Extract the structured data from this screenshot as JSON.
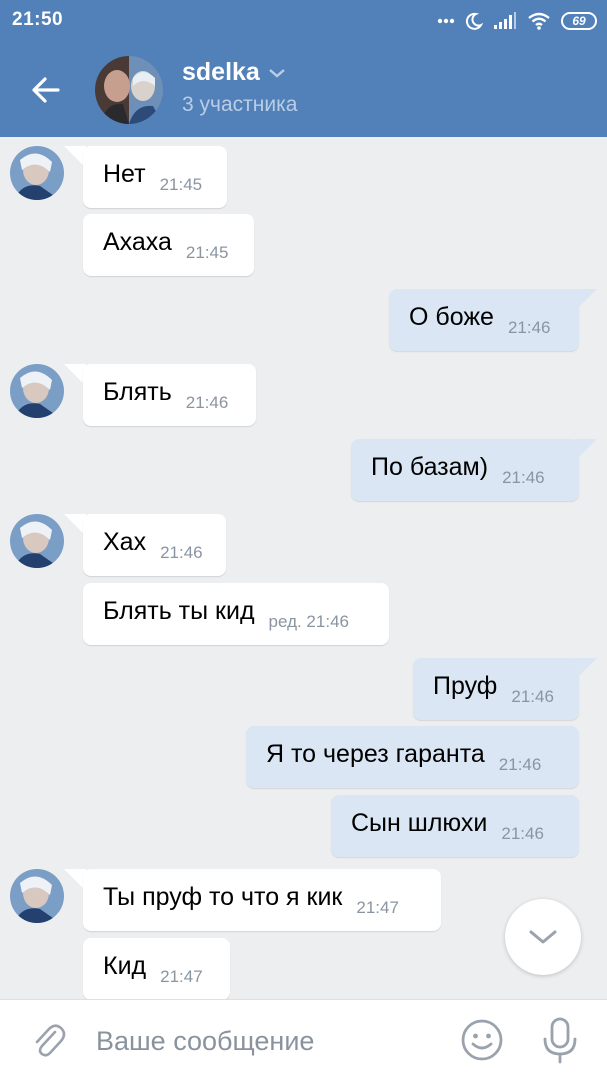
{
  "status_bar": {
    "time": "21:50",
    "battery": "69"
  },
  "header": {
    "title": "sdelka",
    "subtitle": "3 участника"
  },
  "messages": [
    {
      "dir": "in",
      "text": "Нет",
      "time": "21:45"
    },
    {
      "dir": "in",
      "text": "Ахаха",
      "time": "21:45"
    },
    {
      "dir": "out",
      "text": "О боже",
      "time": "21:46"
    },
    {
      "dir": "in",
      "text": "Блять",
      "time": "21:46"
    },
    {
      "dir": "out",
      "text": "По базам)",
      "time": "21:46"
    },
    {
      "dir": "in",
      "text": "Хах",
      "time": "21:46"
    },
    {
      "dir": "in",
      "text": "Блять ты кид",
      "time": "ред. 21:46"
    },
    {
      "dir": "out",
      "text": "Пруф",
      "time": "21:46"
    },
    {
      "dir": "out",
      "text": "Я то через гаранта",
      "time": "21:46"
    },
    {
      "dir": "out",
      "text": "Сын шлюхи",
      "time": "21:46"
    },
    {
      "dir": "in",
      "text": "Ты пруф то что я кик",
      "time": "21:47"
    },
    {
      "dir": "in",
      "text": "Кид",
      "time": "21:47"
    }
  ],
  "input": {
    "placeholder": "Ваше сообщение"
  },
  "colors": {
    "header": "#5181b8",
    "background": "#edeef0",
    "outgoing": "#dae6f4",
    "incoming": "#ffffff"
  },
  "icons": [
    "back-arrow-icon",
    "chevron-down-icon",
    "paperclip-icon",
    "emoji-icon",
    "microphone-icon",
    "scroll-down-icon"
  ]
}
